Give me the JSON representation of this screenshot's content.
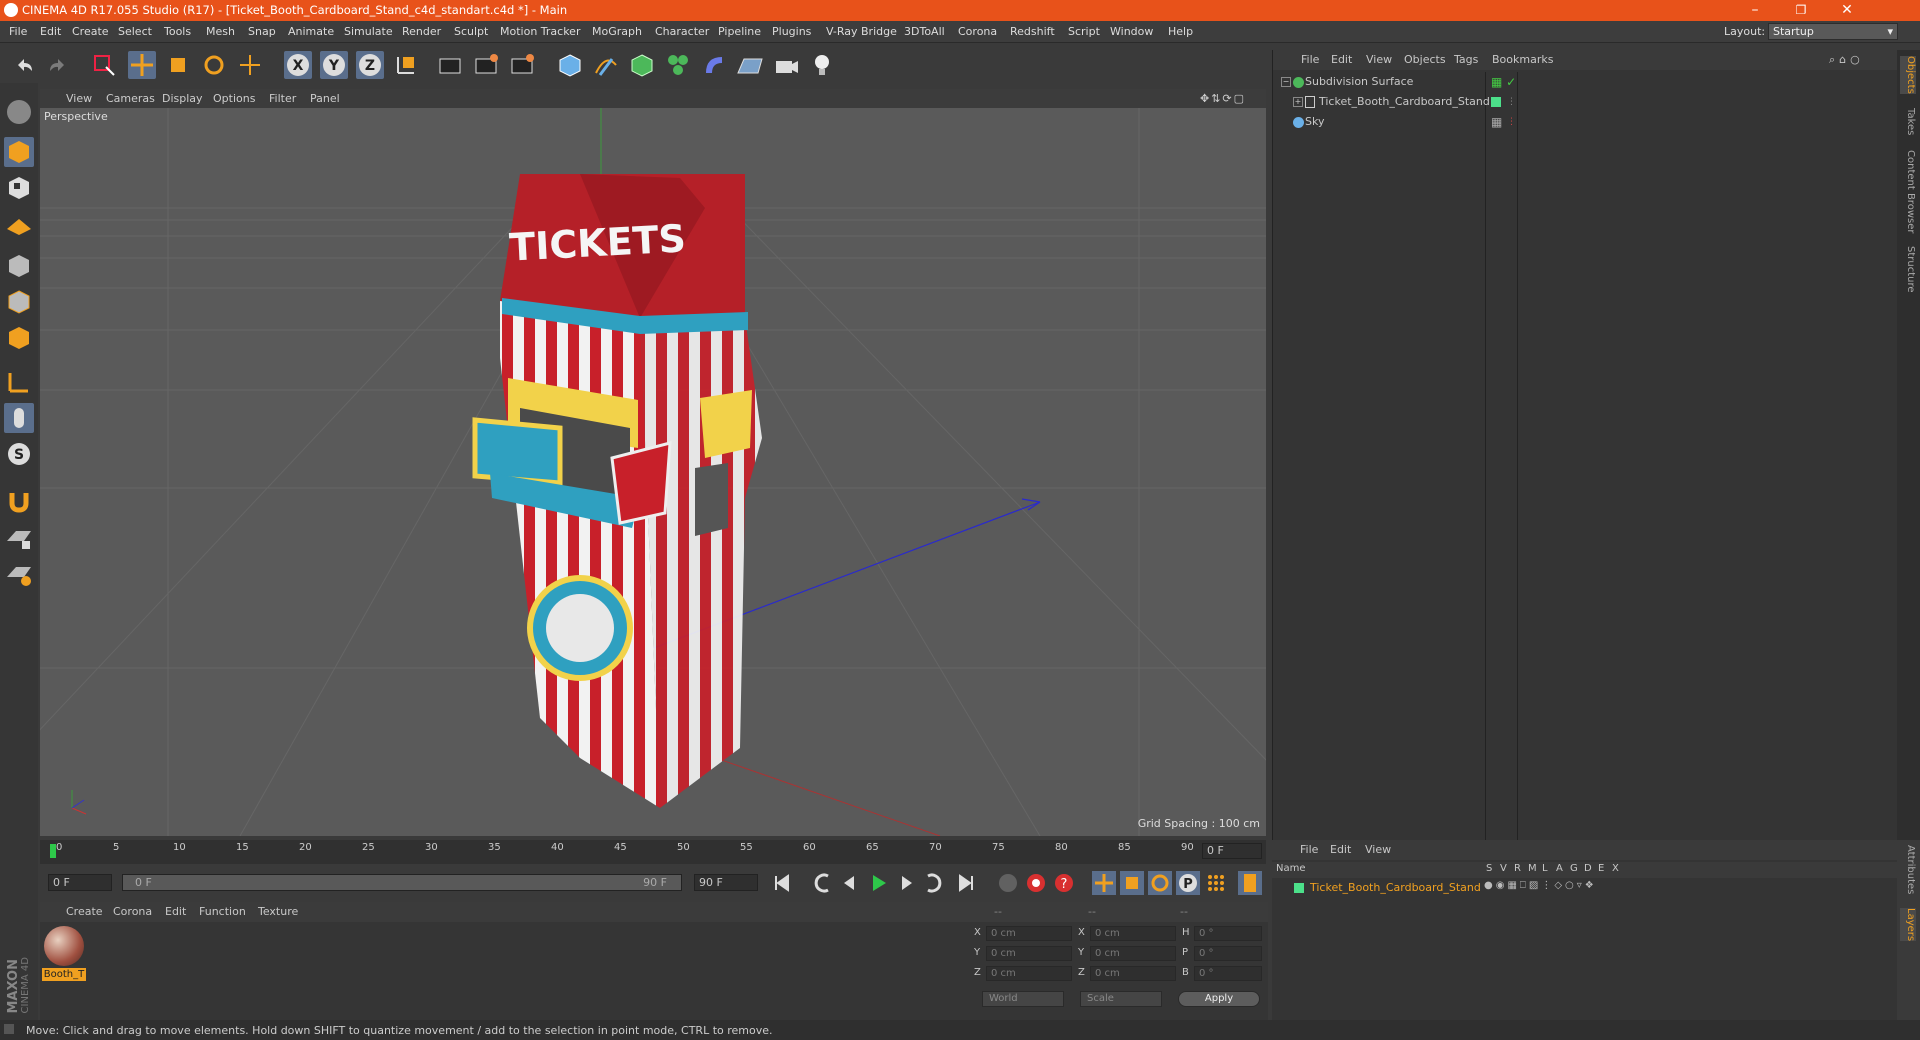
{
  "window": {
    "title": "CINEMA 4D R17.055 Studio (R17) - [Ticket_Booth_Cardboard_Stand_c4d_standart.c4d *] - Main",
    "min_label": "–",
    "max_label": "❐",
    "close_label": "✕"
  },
  "menu": [
    "File",
    "Edit",
    "Create",
    "Select",
    "Tools",
    "Mesh",
    "Snap",
    "Animate",
    "Simulate",
    "Render",
    "Sculpt",
    "Motion Tracker",
    "MoGraph",
    "Character",
    "Pipeline",
    "Plugins",
    "V-Ray Bridge",
    "3DToAll",
    "Corona",
    "Redshift",
    "Script",
    "Window",
    "Help"
  ],
  "layout": {
    "label": "Layout:",
    "value": "Startup"
  },
  "viewport": {
    "menu": [
      "View",
      "Cameras",
      "Display",
      "Options",
      "Filter",
      "Panel"
    ],
    "label": "Perspective",
    "grid_spacing": "Grid Spacing : 100 cm",
    "booth_sign": "TICKETS"
  },
  "objects": {
    "menu": [
      "File",
      "Edit",
      "View",
      "Objects",
      "Tags",
      "Bookmarks"
    ],
    "items": [
      "Subdivision Surface",
      "Ticket_Booth_Cardboard_Stand",
      "Sky"
    ]
  },
  "right_tabs": [
    "Objects",
    "Takes",
    "Content Browser",
    "Structure"
  ],
  "right_tabs_bottom": [
    "Attributes",
    "Layers"
  ],
  "timeline": {
    "ticks": [
      "0",
      "5",
      "10",
      "15",
      "20",
      "25",
      "30",
      "35",
      "40",
      "45",
      "50",
      "55",
      "60",
      "65",
      "70",
      "75",
      "80",
      "85",
      "90"
    ],
    "current": "0 F",
    "start": "0 F",
    "range_start": "0 F",
    "range_end": "90 F",
    "end": "90 F"
  },
  "materials": {
    "menu": [
      "Create",
      "Corona",
      "Edit",
      "Function",
      "Texture"
    ],
    "material_name": "Booth_T"
  },
  "coords": {
    "header": [
      "--",
      "--",
      "--"
    ],
    "rows": [
      {
        "a": "X",
        "v1": "0 cm",
        "b": "X",
        "v2": "0 cm",
        "c": "H",
        "v3": "0 °"
      },
      {
        "a": "Y",
        "v1": "0 cm",
        "b": "Y",
        "v2": "0 cm",
        "c": "P",
        "v3": "0 °"
      },
      {
        "a": "Z",
        "v1": "0 cm",
        "b": "Z",
        "v2": "0 cm",
        "c": "B",
        "v3": "0 °"
      }
    ],
    "space": "World",
    "mode": "Scale",
    "apply": "Apply"
  },
  "layers": {
    "menu": [
      "File",
      "Edit",
      "View"
    ],
    "col_name": "Name",
    "cols": [
      "S",
      "V",
      "R",
      "M",
      "L",
      "A",
      "G",
      "D",
      "E",
      "X"
    ],
    "item": "Ticket_Booth_Cardboard_Stand"
  },
  "brand": {
    "line1": "MAXON",
    "line2": "CINEMA 4D"
  },
  "status": "Move: Click and drag to move elements. Hold down SHIFT to quantize movement / add to the selection in point mode, CTRL to remove.",
  "colors": {
    "title_bar": "#e8521a",
    "accent": "#f0a020",
    "selected": "#5a6e8c"
  }
}
